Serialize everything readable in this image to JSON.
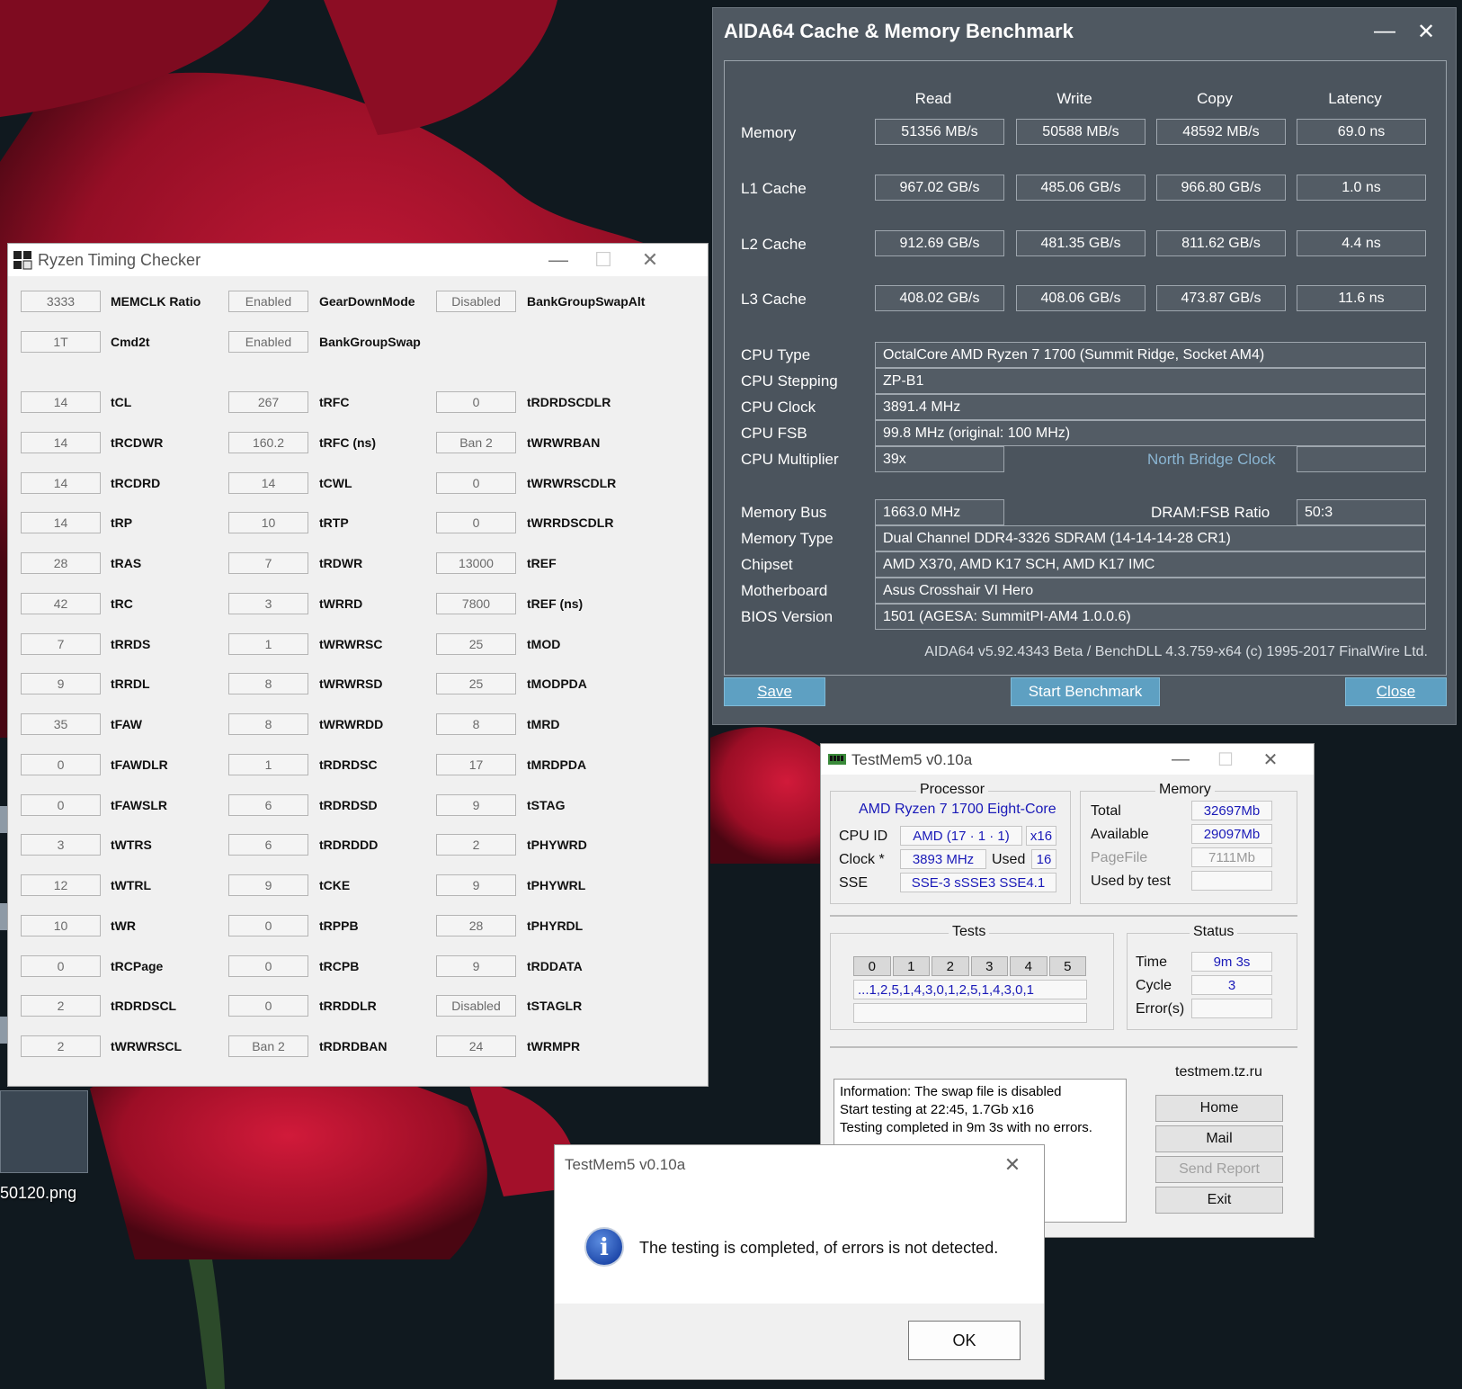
{
  "desktop": {
    "file_label": "50120.png",
    "accent": "#b4122a"
  },
  "aida": {
    "title": "AIDA64 Cache & Memory Benchmark",
    "headers": [
      "Read",
      "Write",
      "Copy",
      "Latency"
    ],
    "rows": [
      {
        "label": "Memory",
        "values": [
          "51356 MB/s",
          "50588 MB/s",
          "48592 MB/s",
          "69.0 ns"
        ]
      },
      {
        "label": "L1 Cache",
        "values": [
          "967.02 GB/s",
          "485.06 GB/s",
          "966.80 GB/s",
          "1.0 ns"
        ]
      },
      {
        "label": "L2 Cache",
        "values": [
          "912.69 GB/s",
          "481.35 GB/s",
          "811.62 GB/s",
          "4.4 ns"
        ]
      },
      {
        "label": "L3 Cache",
        "values": [
          "408.02 GB/s",
          "408.06 GB/s",
          "473.87 GB/s",
          "11.6 ns"
        ]
      }
    ],
    "info": [
      {
        "label": "CPU Type",
        "value": "OctalCore AMD Ryzen 7 1700  (Summit Ridge, Socket AM4)"
      },
      {
        "label": "CPU Stepping",
        "value": "ZP-B1"
      },
      {
        "label": "CPU Clock",
        "value": "3891.4 MHz"
      },
      {
        "label": "CPU FSB",
        "value": "99.8 MHz  (original: 100 MHz)"
      },
      {
        "label": "CPU Multiplier",
        "value": "39x"
      }
    ],
    "nb_label": "North Bridge Clock",
    "nb_value": "",
    "memory_bus_label": "Memory Bus",
    "memory_bus_value": "1663.0 MHz",
    "dram_label": "DRAM:FSB Ratio",
    "dram_value": "50:3",
    "info2": [
      {
        "label": "Memory Type",
        "value": "Dual Channel DDR4-3326 SDRAM  (14-14-14-28 CR1)"
      },
      {
        "label": "Chipset",
        "value": "AMD X370, AMD K17 SCH, AMD K17 IMC"
      },
      {
        "label": "Motherboard",
        "value": "Asus Crosshair VI Hero"
      },
      {
        "label": "BIOS Version",
        "value": "1501  (AGESA: SummitPI-AM4 1.0.0.6)"
      }
    ],
    "footer": "AIDA64 v5.92.4343 Beta / BenchDLL 4.3.759-x64  (c) 1995-2017 FinalWire Ltd.",
    "buttons": {
      "save": "Save",
      "start": "Start Benchmark",
      "close": "Close"
    },
    "minimize": "—",
    "close_glyph": "✕"
  },
  "rtc": {
    "title": "Ryzen Timing Checker",
    "minimize": "—",
    "maximize": "☐",
    "close_glyph": "✕",
    "top_rows": [
      [
        {
          "value": "3333",
          "label": "MEMCLK Ratio"
        },
        {
          "value": "Enabled",
          "label": "GearDownMode"
        },
        {
          "value": "Disabled",
          "label": "BankGroupSwapAlt"
        }
      ],
      [
        {
          "value": "1T",
          "label": "Cmd2t"
        },
        {
          "value": "Enabled",
          "label": "BankGroupSwap"
        }
      ]
    ],
    "rows": [
      [
        {
          "value": "14",
          "label": "tCL"
        },
        {
          "value": "267",
          "label": "tRFC"
        },
        {
          "value": "0",
          "label": "tRDRDSCDLR"
        }
      ],
      [
        {
          "value": "14",
          "label": "tRCDWR"
        },
        {
          "value": "160.2",
          "label": "tRFC (ns)"
        },
        {
          "value": "Ban 2",
          "label": "tWRWRBAN"
        }
      ],
      [
        {
          "value": "14",
          "label": "tRCDRD"
        },
        {
          "value": "14",
          "label": "tCWL"
        },
        {
          "value": "0",
          "label": "tWRWRSCDLR"
        }
      ],
      [
        {
          "value": "14",
          "label": "tRP"
        },
        {
          "value": "10",
          "label": "tRTP"
        },
        {
          "value": "0",
          "label": "tWRRDSCDLR"
        }
      ],
      [
        {
          "value": "28",
          "label": "tRAS"
        },
        {
          "value": "7",
          "label": "tRDWR"
        },
        {
          "value": "13000",
          "label": "tREF"
        }
      ],
      [
        {
          "value": "42",
          "label": "tRC"
        },
        {
          "value": "3",
          "label": "tWRRD"
        },
        {
          "value": "7800",
          "label": "tREF (ns)"
        }
      ],
      [
        {
          "value": "7",
          "label": "tRRDS"
        },
        {
          "value": "1",
          "label": "tWRWRSC"
        },
        {
          "value": "25",
          "label": "tMOD"
        }
      ],
      [
        {
          "value": "9",
          "label": "tRRDL"
        },
        {
          "value": "8",
          "label": "tWRWRSD"
        },
        {
          "value": "25",
          "label": "tMODPDA"
        }
      ],
      [
        {
          "value": "35",
          "label": "tFAW"
        },
        {
          "value": "8",
          "label": "tWRWRDD"
        },
        {
          "value": "8",
          "label": "tMRD"
        }
      ],
      [
        {
          "value": "0",
          "label": "tFAWDLR"
        },
        {
          "value": "1",
          "label": "tRDRDSC"
        },
        {
          "value": "17",
          "label": "tMRDPDA"
        }
      ],
      [
        {
          "value": "0",
          "label": "tFAWSLR"
        },
        {
          "value": "6",
          "label": "tRDRDSD"
        },
        {
          "value": "9",
          "label": "tSTAG"
        }
      ],
      [
        {
          "value": "3",
          "label": "tWTRS"
        },
        {
          "value": "6",
          "label": "tRDRDDD"
        },
        {
          "value": "2",
          "label": "tPHYWRD"
        }
      ],
      [
        {
          "value": "12",
          "label": "tWTRL"
        },
        {
          "value": "9",
          "label": "tCKE"
        },
        {
          "value": "9",
          "label": "tPHYWRL"
        }
      ],
      [
        {
          "value": "10",
          "label": "tWR"
        },
        {
          "value": "0",
          "label": "tRPPB"
        },
        {
          "value": "28",
          "label": "tPHYRDL"
        }
      ],
      [
        {
          "value": "0",
          "label": "tRCPage"
        },
        {
          "value": "0",
          "label": "tRCPB"
        },
        {
          "value": "9",
          "label": "tRDDATA"
        }
      ],
      [
        {
          "value": "2",
          "label": "tRDRDSCL"
        },
        {
          "value": "0",
          "label": "tRRDDLR"
        },
        {
          "value": "Disabled",
          "label": "tSTAGLR"
        }
      ],
      [
        {
          "value": "2",
          "label": "tWRWRSCL"
        },
        {
          "value": "Ban 2",
          "label": "tRDRDBAN"
        },
        {
          "value": "24",
          "label": "tWRMPR"
        }
      ]
    ]
  },
  "tm5": {
    "title": "TestMem5 v0.10a",
    "minimize": "—",
    "maximize": "☐",
    "close_glyph": "✕",
    "processor": {
      "caption": "Processor",
      "name": "AMD Ryzen 7 1700 Eight-Core",
      "cpu_id_label": "CPU ID",
      "cpu_id_value": "AMD  (17 · 1 · 1)",
      "threads": "x16",
      "clock_label": "Clock *",
      "clock_value": "3893 MHz",
      "used_label": "Used",
      "used_value": "16",
      "sse_label": "SSE",
      "sse_value": "SSE-3 sSSE3 SSE4.1"
    },
    "memory": {
      "caption": "Memory",
      "total_label": "Total",
      "total_value": "32697Mb",
      "available_label": "Available",
      "available_value": "29097Mb",
      "pagefile_label": "PageFile",
      "pagefile_value": "7111Mb",
      "usedby_label": "Used by test",
      "usedby_value": ""
    },
    "tests": {
      "caption": "Tests",
      "numbers": [
        "0",
        "1",
        "2",
        "3",
        "4",
        "5"
      ],
      "sequence": "...1,2,5,1,4,3,0,1,2,5,1,4,3,0,1",
      "extra": ""
    },
    "status": {
      "caption": "Status",
      "time_label": "Time",
      "time_value": "9m 3s",
      "cycle_label": "Cycle",
      "cycle_value": "3",
      "errors_label": "Error(s)",
      "errors_value": ""
    },
    "log": [
      "Information: The swap file is disabled",
      "Start testing at 22:45, 1.7Gb x16",
      "Testing completed in 9m 3s with no errors."
    ],
    "links": {
      "caption": "testmem.tz.ru",
      "home": "Home",
      "mail": "Mail",
      "send": "Send Report",
      "exit": "Exit"
    }
  },
  "dialog": {
    "title": "TestMem5 v0.10a",
    "close_glyph": "✕",
    "icon_glyph": "i",
    "message": "The testing is completed, of errors is not detected.",
    "ok": "OK"
  }
}
